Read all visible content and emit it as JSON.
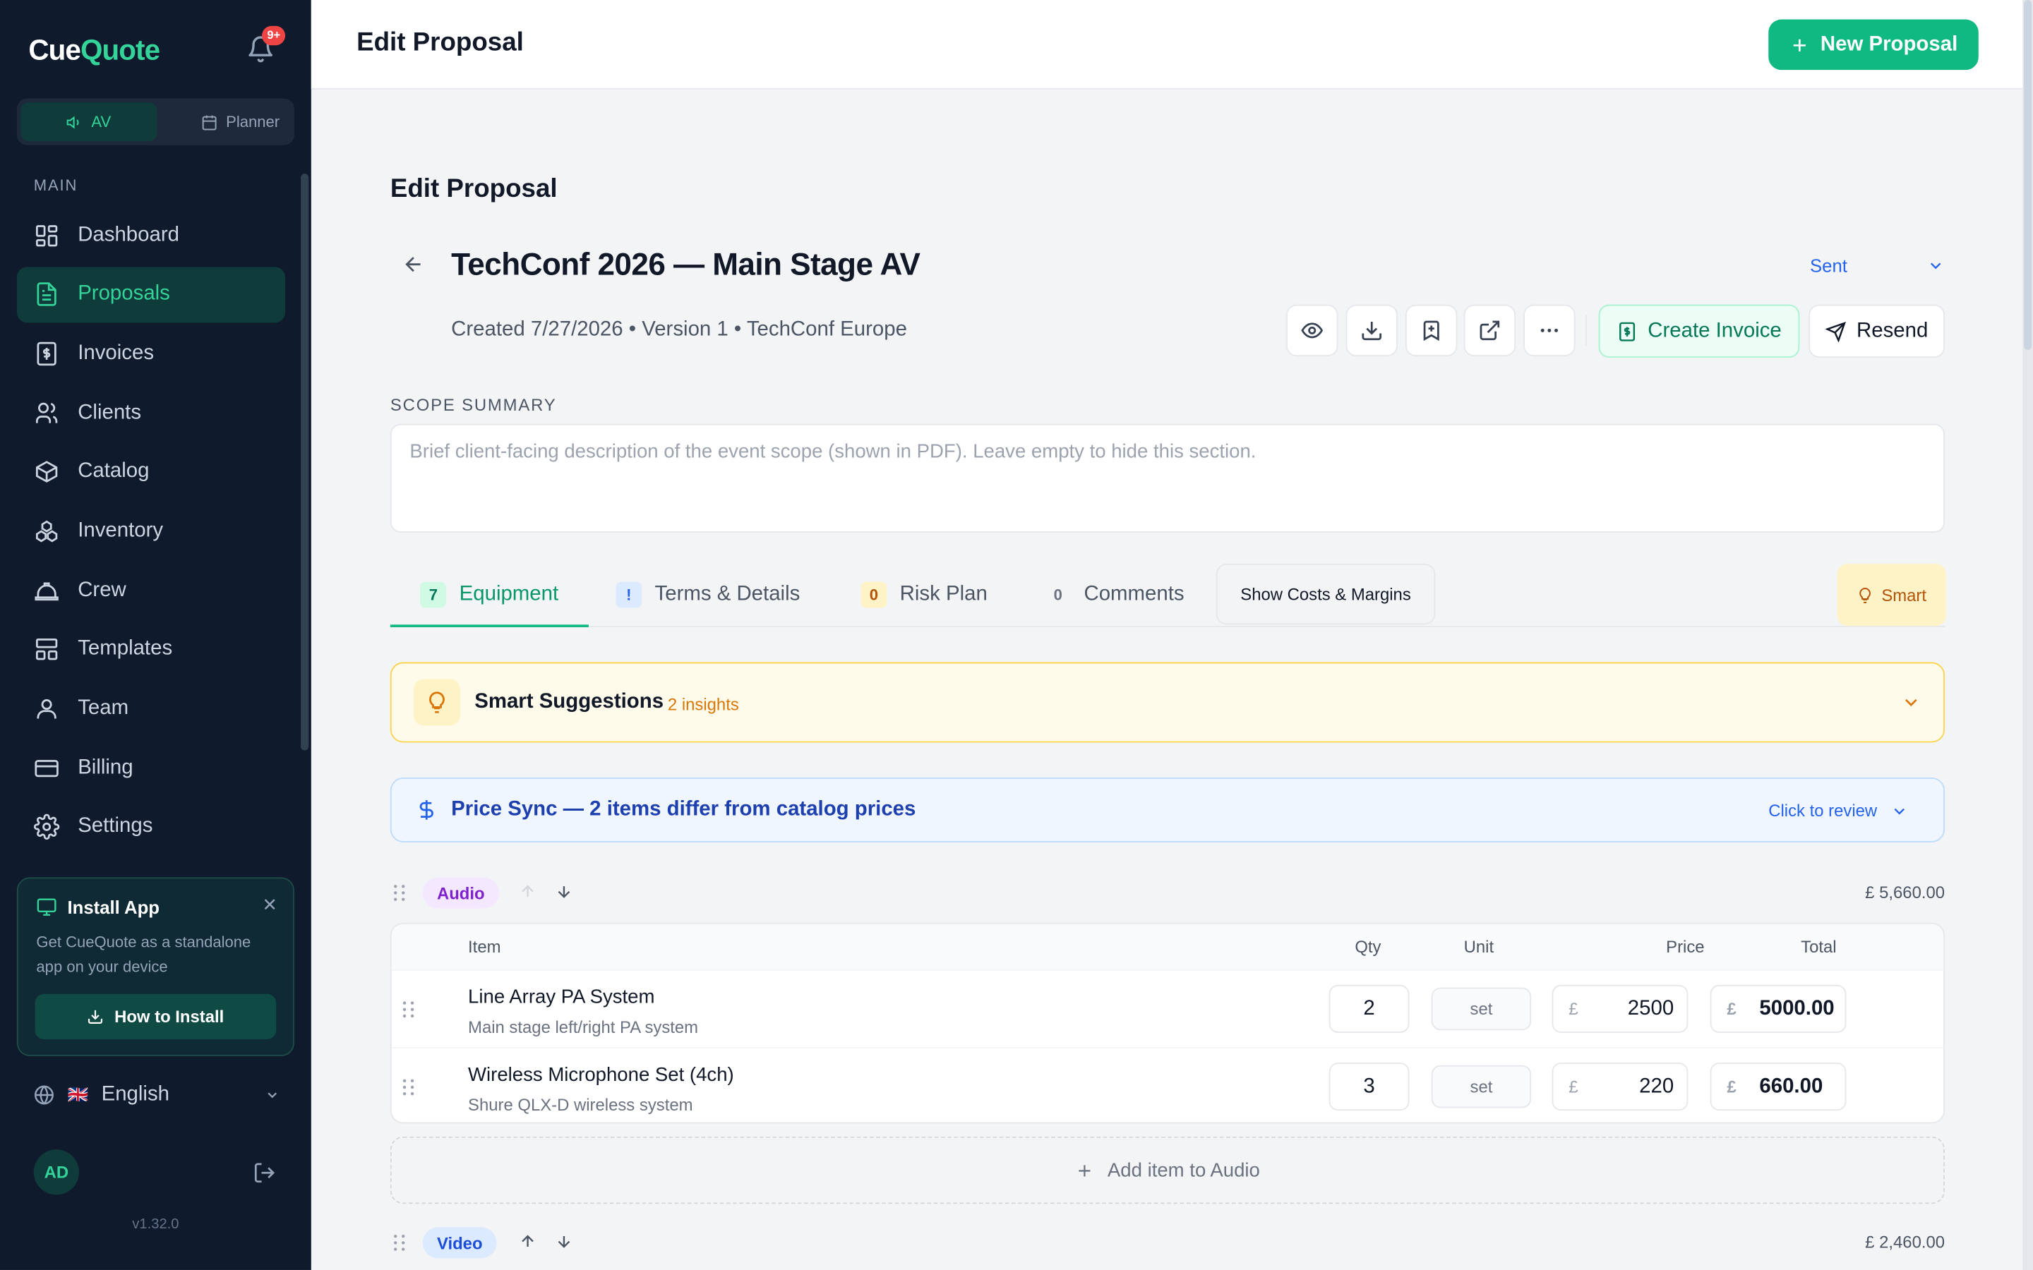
{
  "app": {
    "logo_part1": "Cue",
    "logo_part2": "Quote",
    "notifications_badge": "9+",
    "version": "v1.32.0"
  },
  "mode_switch": {
    "av_label": "AV",
    "planner_label": "Planner"
  },
  "sidebar": {
    "section_label": "MAIN",
    "items": [
      {
        "label": "Dashboard",
        "icon": "grid-icon"
      },
      {
        "label": "Proposals",
        "icon": "document-icon",
        "active": true
      },
      {
        "label": "Invoices",
        "icon": "receipt-icon"
      },
      {
        "label": "Clients",
        "icon": "users-icon"
      },
      {
        "label": "Catalog",
        "icon": "box-icon"
      },
      {
        "label": "Inventory",
        "icon": "boxes-icon"
      },
      {
        "label": "Crew",
        "icon": "hardhat-icon"
      },
      {
        "label": "Templates",
        "icon": "layout-icon"
      },
      {
        "label": "Team",
        "icon": "user-icon"
      },
      {
        "label": "Billing",
        "icon": "credit-card-icon"
      },
      {
        "label": "Settings",
        "icon": "gear-icon"
      }
    ]
  },
  "install_card": {
    "title": "Install App",
    "description": "Get CueQuote as a standalone app on your device",
    "button": "How to Install"
  },
  "language": {
    "label": "English",
    "flag": "🇬🇧"
  },
  "user": {
    "initials": "AD"
  },
  "topbar": {
    "title": "Edit Proposal",
    "new_button": "New Proposal"
  },
  "proposal": {
    "page_heading": "Edit Proposal",
    "title": "TechConf 2026 — Main Stage AV",
    "status": "Sent",
    "meta": "Created 7/27/2026 • Version 1 • TechConf Europe",
    "create_invoice": "Create Invoice",
    "resend": "Resend"
  },
  "scope": {
    "label": "SCOPE SUMMARY",
    "placeholder": "Brief client-facing description of the event scope (shown in PDF). Leave empty to hide this section.",
    "value": ""
  },
  "tabs": {
    "equipment": {
      "count": "7",
      "label": "Equipment"
    },
    "terms": {
      "count": "!",
      "label": "Terms & Details"
    },
    "risk": {
      "count": "0",
      "label": "Risk Plan"
    },
    "comments": {
      "count": "0",
      "label": "Comments"
    },
    "costs_button": "Show Costs & Margins",
    "smart_button": "Smart"
  },
  "suggestions": {
    "title": "Smart Suggestions",
    "count": "2 insights"
  },
  "price_sync": {
    "title": "Price Sync — 2 items differ from catalog prices",
    "action": "Click to review"
  },
  "groups": {
    "audio": {
      "name": "Audio",
      "total": "£ 5,660.00",
      "columns": {
        "item": "Item",
        "qty": "Qty",
        "unit": "Unit",
        "price": "Price",
        "total": "Total"
      },
      "rows": [
        {
          "name": "Line Array PA System",
          "desc": "Main stage left/right PA system",
          "qty": "2",
          "unit": "set",
          "currency": "£",
          "price": "2500",
          "total": "5000.00"
        },
        {
          "name": "Wireless Microphone Set (4ch)",
          "desc": "Shure QLX-D wireless system",
          "qty": "3",
          "unit": "set",
          "currency": "£",
          "price": "220",
          "total": "660.00"
        }
      ],
      "add_label": "Add item to Audio"
    },
    "video": {
      "name": "Video",
      "total": "£ 2,460.00"
    }
  },
  "colors": {
    "brand": "#10b981",
    "sidebar_bg": "#0f1b2d",
    "accent_blue": "#2563eb",
    "amber": "#d97706"
  }
}
